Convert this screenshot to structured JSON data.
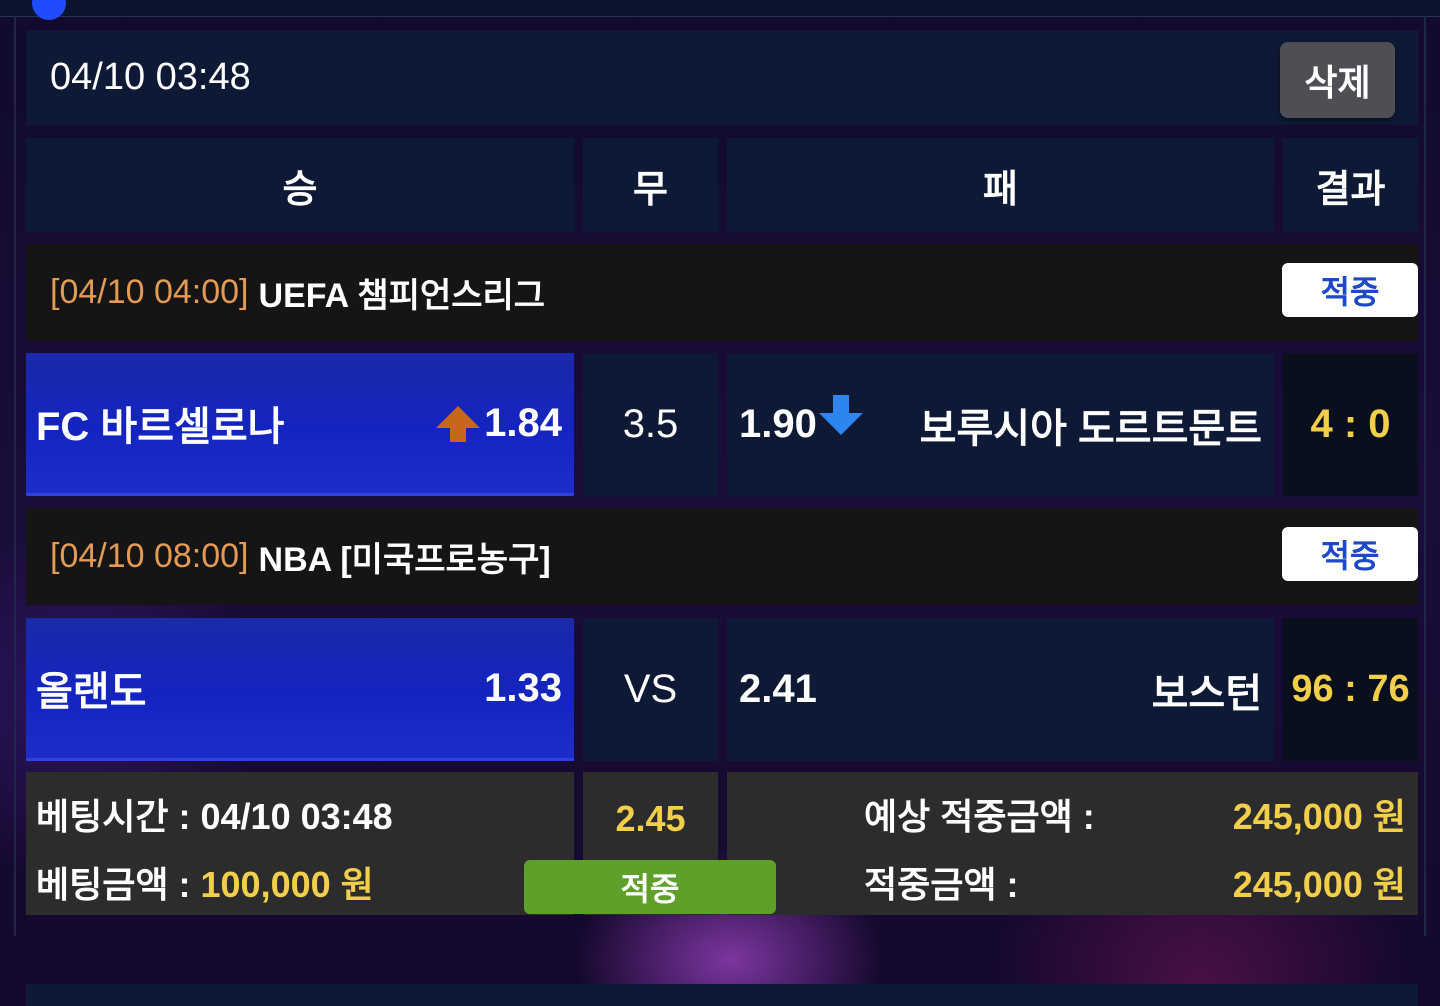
{
  "bet_time": "04/10 03:48",
  "delete_label": "삭제",
  "headers": {
    "win": "승",
    "draw": "무",
    "lose": "패",
    "result": "결과"
  },
  "games": [
    {
      "date": "[04/10 04:00]",
      "league": "UEFA 챔피언스리그",
      "status": "적중",
      "home_team": "FC 바르셀로나",
      "home_odds": "1.84",
      "home_trend": "up-arrow-icon",
      "draw_value": "3.5",
      "away_odds": "1.90",
      "away_trend": "down-arrow-icon",
      "away_team": "보루시아 도르트문트",
      "score": "4 : 0"
    },
    {
      "date": "[04/10 08:00]",
      "league": "NBA [미국프로농구]",
      "status": "적중",
      "home_team": "올랜도",
      "home_odds": "1.33",
      "draw_value": "VS",
      "away_odds": "2.41",
      "away_team": "보스턴",
      "score": "96 : 76"
    }
  ],
  "summary": {
    "bet_time_label": "베팅시간 :",
    "bet_time_value": "04/10 03:48",
    "bet_amount_label": "베팅금액 :",
    "bet_amount_value": "100,000 원",
    "total_odds": "2.45",
    "result_badge": "적중",
    "expected_label": "예상 적중금액 :",
    "expected_value": "245,000 원",
    "won_label": "적중금액 :",
    "won_value": "245,000 원"
  },
  "colors": {
    "accent_gold": "#f2cf4a",
    "league_date": "#e39a55",
    "home_blue": "#1424c0",
    "hit_green": "#5ea02a",
    "hit_text_blue": "#1d49c9"
  }
}
